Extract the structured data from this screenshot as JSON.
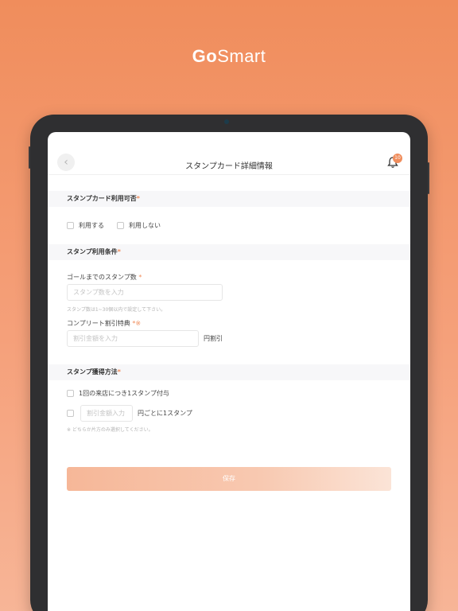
{
  "brand": {
    "logo_part1": "Go",
    "logo_part2": "Smart"
  },
  "header": {
    "back_icon": "chevron-left-icon",
    "title": "スタンプカード詳細情報",
    "notification_badge": "10"
  },
  "section1": {
    "heading": "スタンプカード利用可否",
    "required_mark": "*",
    "options": [
      "利用する",
      "利用しない"
    ]
  },
  "section2": {
    "heading": "スタンプ利用条件",
    "required_mark": "*",
    "goal_label": "ゴールまでのスタンプ数",
    "goal_required": "*",
    "goal_placeholder": "スタンプ数を入力",
    "goal_hint": "スタンプ数は1~30個以内で設定して下さい。",
    "discount_label": "コンプリート割引特典",
    "discount_required": "*※",
    "discount_placeholder": "割引金額を入力",
    "discount_unit": "円割引"
  },
  "section3": {
    "heading": "スタンプ獲得方法",
    "required_mark": "*",
    "option1": "1回の来店につき1スタンプ付与",
    "option2_placeholder": "割引金額入力",
    "option2_unit": "円ごとに1スタンプ",
    "hint": "※ どちらか片方のみ選択してください。"
  },
  "save_label": "保存",
  "colors": {
    "accent": "#f08d5c",
    "section_bg": "#f7f7f9",
    "tablet_bezel": "#2f2f31"
  }
}
